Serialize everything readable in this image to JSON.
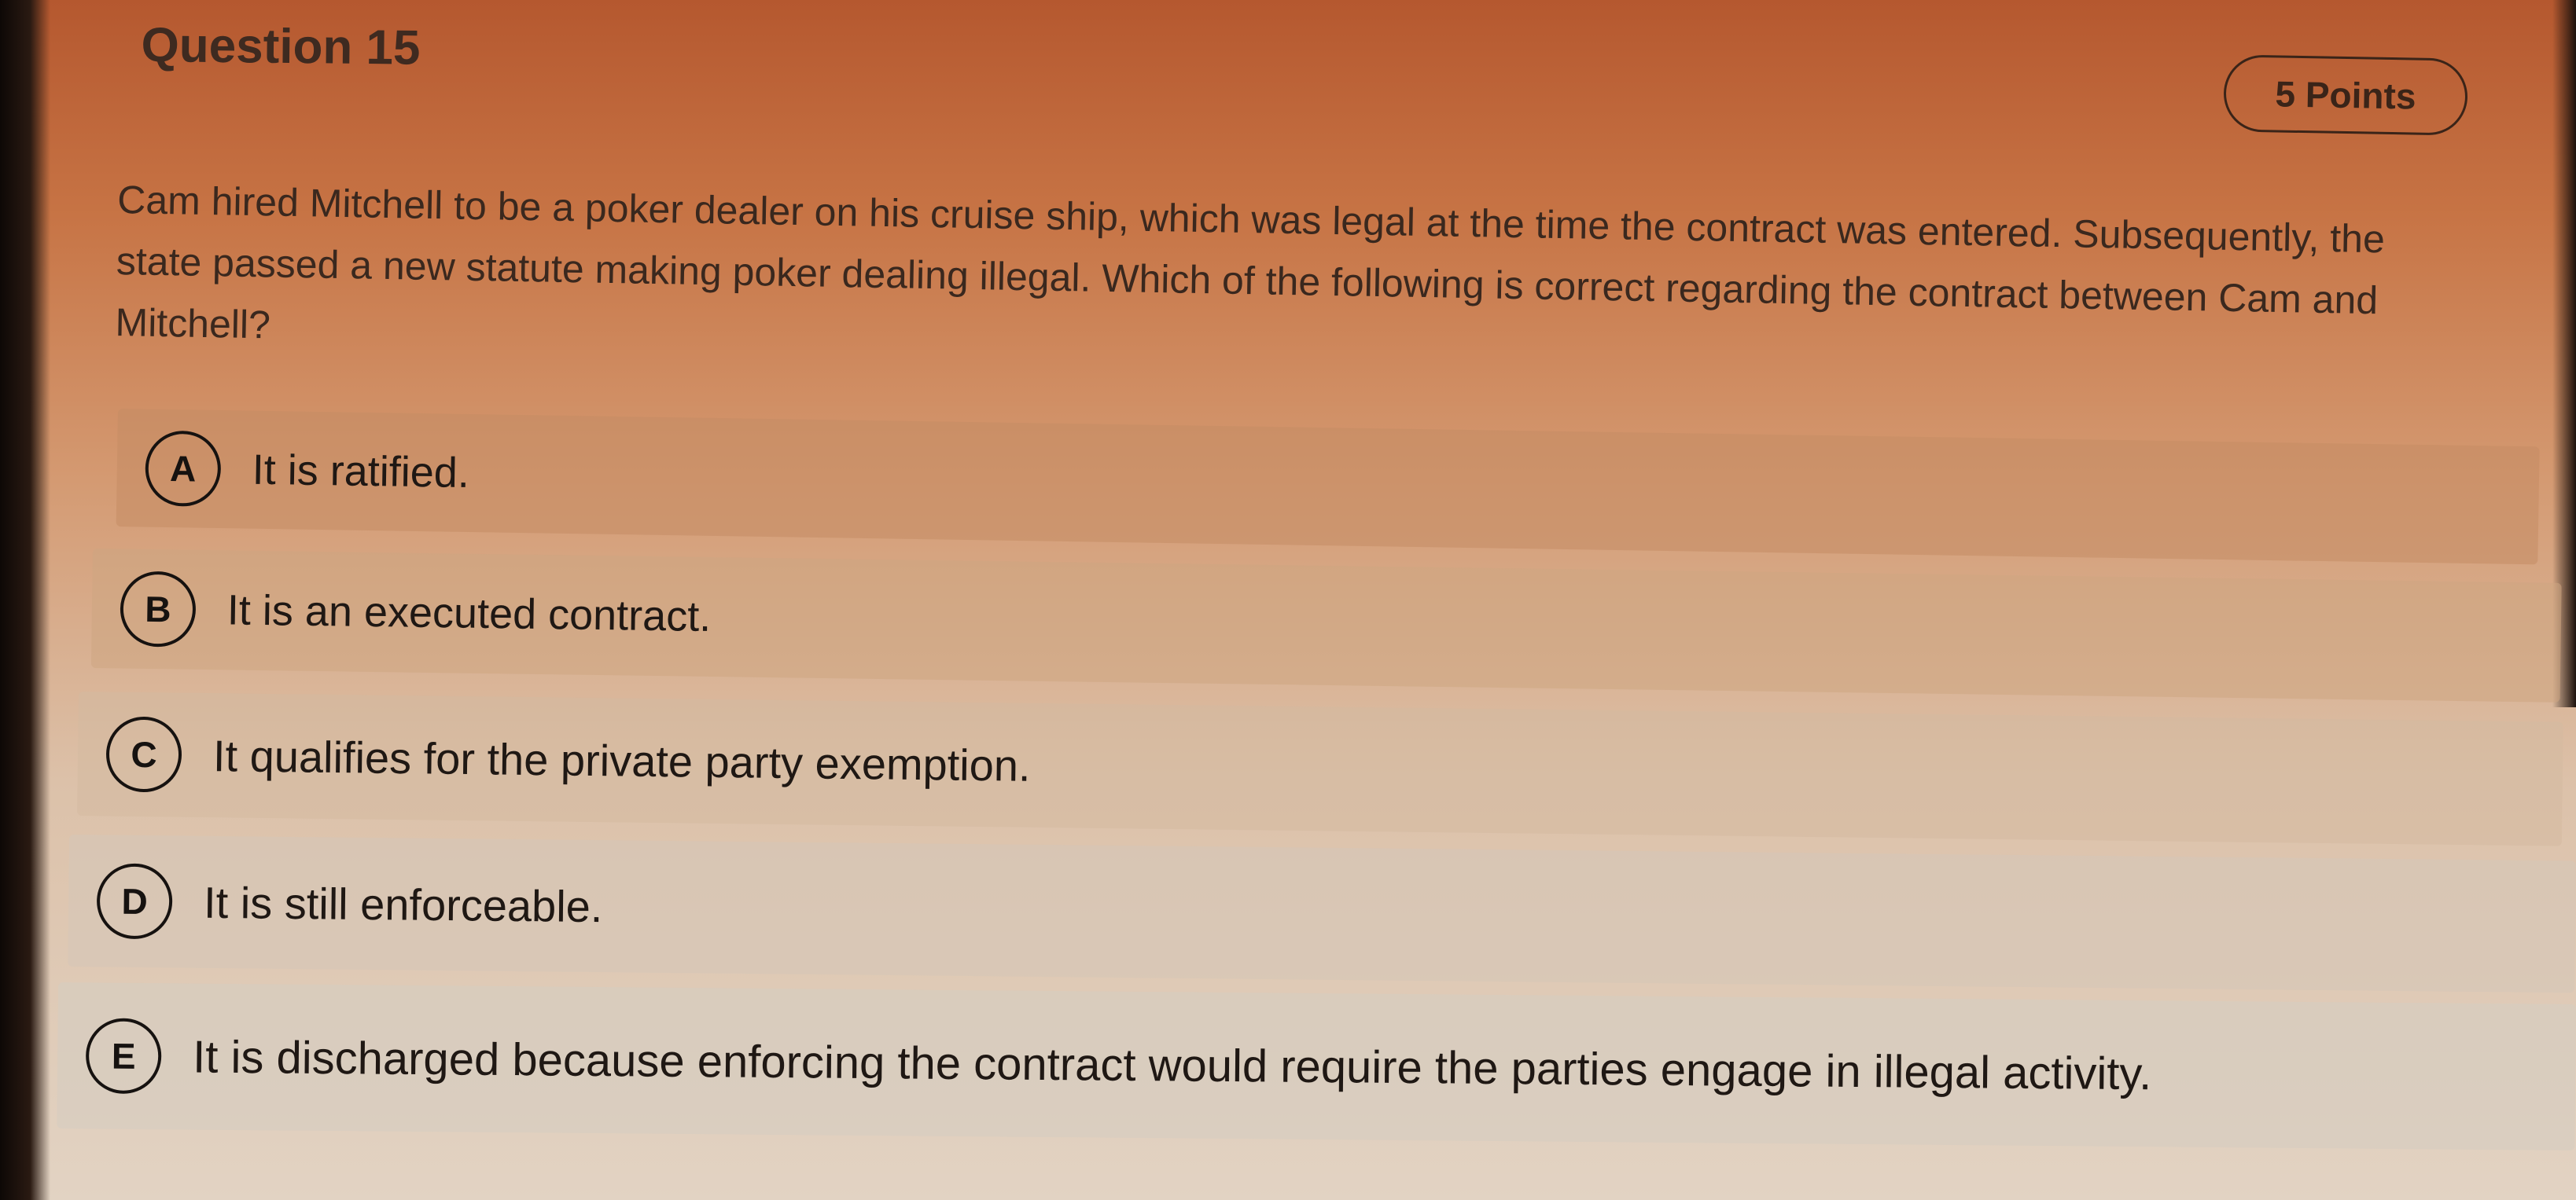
{
  "question": {
    "title": "Question 15",
    "points": "5 Points",
    "text": "Cam hired Mitchell to be a poker dealer on his cruise ship, which was legal at the time the contract was entered. Subsequently, the state passed a new statute making poker dealing illegal. Which of the following is correct regarding the contract between Cam and Mitchell?"
  },
  "options": [
    {
      "letter": "A",
      "text": "It is ratified."
    },
    {
      "letter": "B",
      "text": "It is an executed contract."
    },
    {
      "letter": "C",
      "text": "It qualifies for the private party exemption."
    },
    {
      "letter": "D",
      "text": "It is still enforceable."
    },
    {
      "letter": "E",
      "text": "It is discharged because enforcing the contract would require the parties engage in illegal activity."
    }
  ]
}
